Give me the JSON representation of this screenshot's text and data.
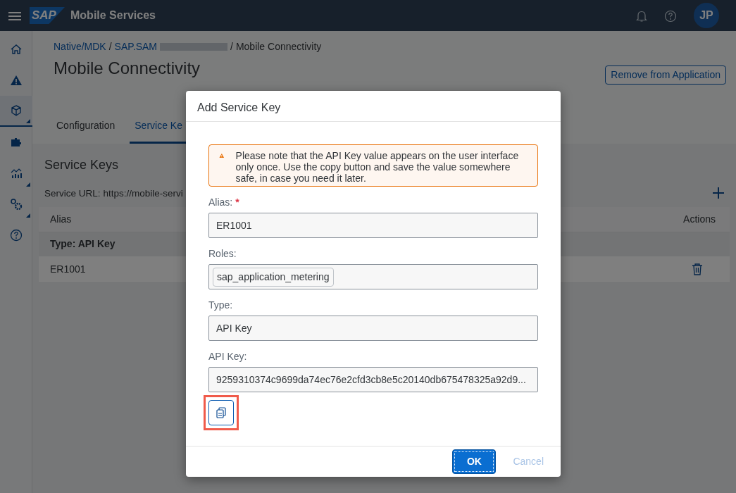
{
  "shell": {
    "logo_text": "SAP",
    "title": "Mobile Services",
    "avatar": "JP"
  },
  "sidebar": {
    "items": [
      {
        "kind": "home",
        "selected": false,
        "has_submenu": false
      },
      {
        "kind": "warning",
        "selected": false,
        "has_submenu": false
      },
      {
        "kind": "cube",
        "selected": true,
        "has_submenu": true
      },
      {
        "kind": "puzzle",
        "selected": false,
        "has_submenu": false
      },
      {
        "kind": "chart",
        "selected": false,
        "has_submenu": true
      },
      {
        "kind": "gears",
        "selected": false,
        "has_submenu": true
      },
      {
        "kind": "help",
        "selected": false,
        "has_submenu": false
      }
    ]
  },
  "breadcrumb": {
    "separator": "/",
    "items": [
      {
        "label": "Native/MDK",
        "link": true,
        "redacted": false
      },
      {
        "label": "SAP.SAM",
        "link": true,
        "redacted": true
      },
      {
        "label": "Mobile Connectivity",
        "link": false,
        "redacted": false
      }
    ]
  },
  "page_title": "Mobile Connectivity",
  "header_button": "Remove from Application",
  "tabs": [
    {
      "label": "Configuration",
      "selected": false
    },
    {
      "label": "Service Ke",
      "selected": true
    }
  ],
  "section": {
    "title": "Service Keys",
    "url_label": "Service URL:",
    "url": "https://mobile-servi"
  },
  "table": {
    "columns": [
      "Alias",
      "Actions"
    ],
    "groups": [
      {
        "label": "Type: API Key",
        "rows": [
          {
            "alias": "ER1001"
          }
        ]
      }
    ]
  },
  "dialog": {
    "title": "Add Service Key",
    "warning": "Please note that the API Key value appears on the user interface only once. Use the copy button and save the value somewhere safe, in case you need it later.",
    "fields": [
      {
        "kind": "text",
        "label": "Alias:",
        "required_mark": "*",
        "value": "ER1001"
      },
      {
        "kind": "tokens",
        "label": "Roles:",
        "tokens": [
          "sap_application_metering"
        ]
      },
      {
        "kind": "text",
        "label": "Type:",
        "value": "API Key"
      },
      {
        "kind": "text",
        "label": "API Key:",
        "value": "9259310374c9699da74ec76e2cfd3cb8e5c20140db675478325a92d9..."
      }
    ],
    "copy_button": {
      "highlighted": true
    },
    "buttons": [
      {
        "label": "OK",
        "kind": "primary",
        "disabled": false
      },
      {
        "label": "Cancel",
        "kind": "ghost",
        "disabled": true
      }
    ]
  }
}
